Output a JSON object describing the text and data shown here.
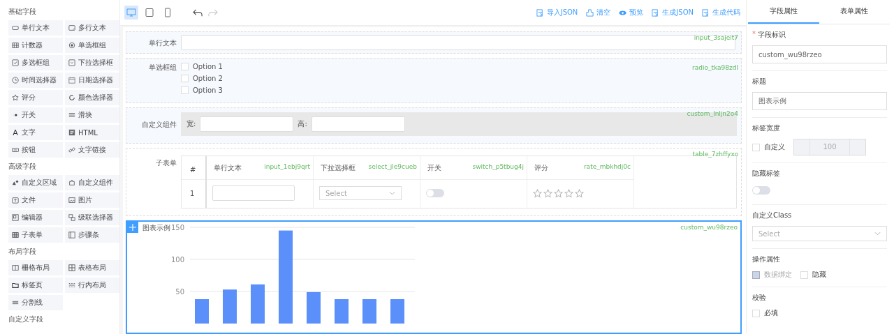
{
  "sidebar": {
    "sections": [
      {
        "title": "基础字段",
        "items": [
          {
            "label": "单行文本"
          },
          {
            "label": "多行文本"
          },
          {
            "label": "计数器"
          },
          {
            "label": "单选框组"
          },
          {
            "label": "多选框组"
          },
          {
            "label": "下拉选择框"
          },
          {
            "label": "时间选择器"
          },
          {
            "label": "日期选择器"
          },
          {
            "label": "评分"
          },
          {
            "label": "颜色选择器"
          },
          {
            "label": "开关"
          },
          {
            "label": "滑块"
          },
          {
            "label": "文字",
            "glyph": "A"
          },
          {
            "label": "HTML"
          },
          {
            "label": "按钮"
          },
          {
            "label": "文字链接"
          }
        ]
      },
      {
        "title": "高级字段",
        "items": [
          {
            "label": "自定义区域"
          },
          {
            "label": "自定义组件"
          },
          {
            "label": "文件"
          },
          {
            "label": "图片"
          },
          {
            "label": "编辑器"
          },
          {
            "label": "级联选择器"
          },
          {
            "label": "子表单"
          },
          {
            "label": "步骤条"
          }
        ]
      },
      {
        "title": "布局字段",
        "items": [
          {
            "label": "栅格布局"
          },
          {
            "label": "表格布局"
          },
          {
            "label": "标签页"
          },
          {
            "label": "行内布局"
          },
          {
            "label": "分割线"
          }
        ]
      },
      {
        "title": "自定义字段"
      }
    ]
  },
  "toolbar": {
    "devices": [
      {
        "kind": "desktop",
        "selected": true
      },
      {
        "kind": "tablet",
        "selected": false
      },
      {
        "kind": "phone",
        "selected": false
      }
    ],
    "undo": {
      "disabled": false
    },
    "redo": {
      "disabled": true
    },
    "actions": [
      {
        "kind": "import",
        "label": "导入JSON"
      },
      {
        "kind": "clear",
        "label": "清空"
      },
      {
        "kind": "preview",
        "label": "预览"
      },
      {
        "kind": "json",
        "label": "生成JSON"
      },
      {
        "kind": "code",
        "label": "生成代码"
      }
    ]
  },
  "canvas": {
    "widgets": [
      {
        "kind": "input",
        "label": "单行文本",
        "tag": "input_3sajeit7",
        "selected": false
      },
      {
        "kind": "radio",
        "label": "单选框组",
        "tag": "radio_tka98zdl",
        "selected": false,
        "options": [
          {
            "label": "Option 1",
            "checked": false
          },
          {
            "label": "Option 2",
            "checked": false
          },
          {
            "label": "Option 3",
            "checked": false
          }
        ]
      },
      {
        "kind": "custom",
        "label": "自定义组件",
        "tag": "custom_lnljn2o4",
        "selected": false,
        "width_label": "宽:",
        "height_label": "高:"
      },
      {
        "kind": "table",
        "label": "子表单",
        "tag": "table_7zhffyxo",
        "selected": false,
        "index_header": "#",
        "row_index": "1",
        "columns": [
          {
            "kind": "input",
            "title": "单行文本",
            "tag": "input_1ebj9qrt"
          },
          {
            "kind": "select",
            "title": "下拉选择框",
            "tag": "select_jle9cueb",
            "placeholder": "Select"
          },
          {
            "kind": "switch",
            "title": "开关",
            "tag": "switch_p5tbug4j",
            "on": false
          },
          {
            "kind": "rate",
            "title": "评分",
            "tag": "rate_mbkhdj0c",
            "stars": 0
          }
        ]
      },
      {
        "kind": "chart",
        "label": "图表示例",
        "tag": "custom_wu98rzeo",
        "selected": true,
        "chart_data": {
          "type": "bar",
          "values": [
            38,
            53,
            61,
            145,
            49,
            38,
            38,
            38
          ],
          "ylim": [
            0,
            150
          ],
          "yticks": [
            50,
            100,
            150
          ],
          "color": "#5b8ff9"
        }
      }
    ]
  },
  "properties": {
    "tabs": [
      {
        "label": "字段属性",
        "selected": true
      },
      {
        "label": "表单属性",
        "selected": false
      }
    ],
    "field_id": {
      "label": "字段标识",
      "required_mark": "*",
      "value": "custom_wu98rzeo"
    },
    "title": {
      "label": "标题",
      "value": "图表示例"
    },
    "label_width": {
      "label": "标签宽度",
      "custom": {
        "label": "自定义",
        "checked": false
      },
      "value": "100",
      "disabled": true
    },
    "hide_label": {
      "label": "隐藏标签",
      "on": false
    },
    "custom_class": {
      "label": "自定义Class",
      "placeholder": "Select"
    },
    "operations": {
      "label": "操作属性",
      "options": [
        {
          "label": "数据绑定",
          "checked": true,
          "disabled": true
        },
        {
          "label": "隐藏",
          "checked": false,
          "disabled": false
        }
      ]
    },
    "validation": {
      "label": "校验",
      "options": [
        {
          "label": "必填",
          "checked": false
        }
      ]
    }
  }
}
